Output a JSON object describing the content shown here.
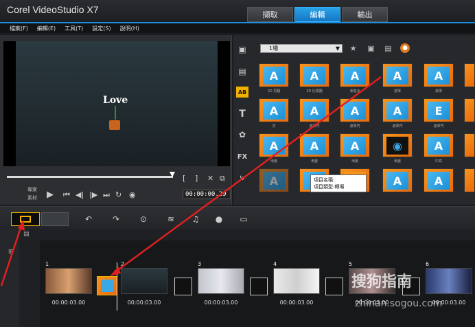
{
  "app": {
    "title": "Corel VideoStudio X7"
  },
  "steps": {
    "capture": "擷取",
    "edit": "編輯",
    "share": "輸出",
    "active": "edit"
  },
  "menu": [
    "檔案(F)",
    "編輯(E)",
    "工具(T)",
    "設定(S)",
    "說明(H)"
  ],
  "player": {
    "preview_text": "Love",
    "timecode": "00:00:00.29",
    "project_label": "專案",
    "clip_label": "素材"
  },
  "library": {
    "gallery_dropdown": "1場",
    "side_icons": [
      "media-icon",
      "instant-project-icon",
      "transition-icon",
      "title-icon",
      "graphic-icon",
      "filter-icon",
      "path-icon"
    ],
    "thumbs": [
      {
        "label": "3D 頁翻"
      },
      {
        "label": "3D 比撲翻"
      },
      {
        "label": "漸進淡"
      },
      {
        "label": "遮罩"
      },
      {
        "label": "遮罩"
      },
      {
        "label": "交"
      },
      {
        "label": "遮罩門"
      },
      {
        "label": "遮罩門"
      },
      {
        "label": "遮罩門"
      },
      {
        "label": "遮罩門"
      },
      {
        "label": "漸變"
      },
      {
        "label": "漸變"
      },
      {
        "label": "漸變"
      },
      {
        "label": "漸變"
      },
      {
        "label": "中高"
      }
    ],
    "tooltip": {
      "line1": "項目名稱:",
      "line2": "項目類型:轉場"
    }
  },
  "storyboard": {
    "clips": [
      {
        "num": "1",
        "duration": "00:00:03.00"
      },
      {
        "num": "2",
        "duration": "00:00:03.00"
      },
      {
        "num": "3",
        "duration": "00:00:03.00"
      },
      {
        "num": "4",
        "duration": "00:00:03.00"
      },
      {
        "num": "5",
        "duration": "00:00:03.00"
      },
      {
        "num": "6",
        "duration": "00:00:03.00"
      }
    ]
  },
  "watermark": {
    "text": "搜狗指南",
    "url": "zhinan.sogou.com"
  },
  "colors": {
    "accent": "#1c8fdc",
    "highlight": "#f2b000",
    "arrow": "#e02020"
  }
}
